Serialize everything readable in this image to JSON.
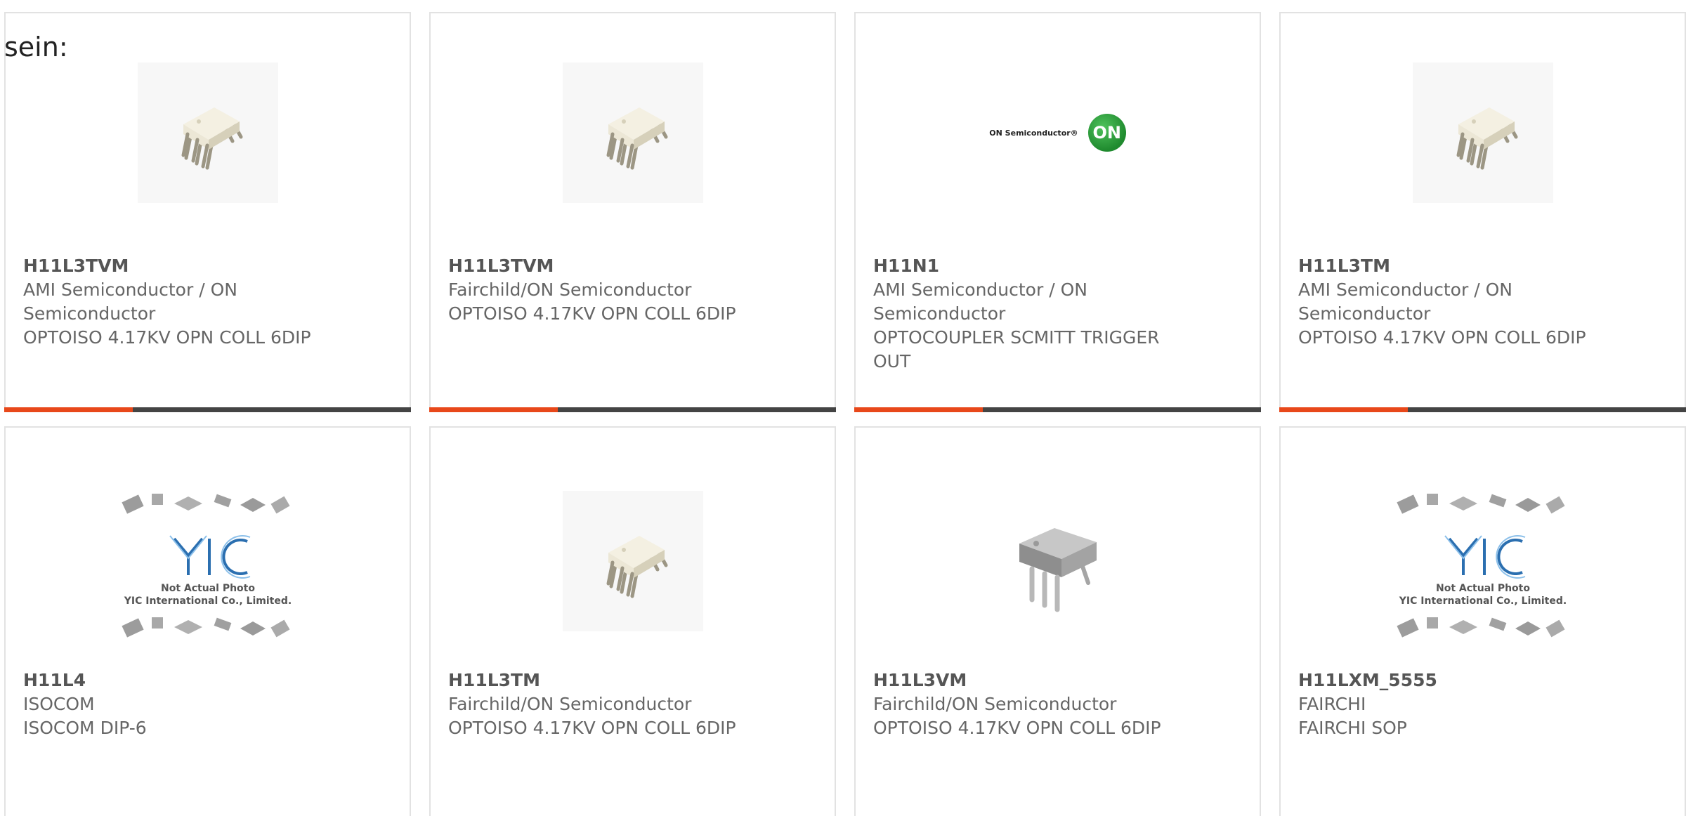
{
  "intro_text": "sein:",
  "colors": {
    "accent": "#e8481a",
    "bar_dark": "#444444",
    "card_border": "#e2e2e2",
    "text_muted": "#666666",
    "on_logo_green": "#1f8a2e"
  },
  "products": [
    {
      "part_number": "H11L3TVM",
      "manufacturer": "AMI Semiconductor / ON Semiconductor",
      "description": "OPTOISO 4.17KV OPN COLL 6DIP",
      "image": "optocoupler-dip6-photo"
    },
    {
      "part_number": "H11L3TVM",
      "manufacturer": "Fairchild/ON Semiconductor",
      "description": "OPTOISO 4.17KV OPN COLL 6DIP",
      "image": "optocoupler-dip6-photo"
    },
    {
      "part_number": "H11N1",
      "manufacturer": "AMI Semiconductor / ON Semiconductor",
      "description": "OPTOCOUPLER SCMITT TRIGGER OUT",
      "image": "on-semiconductor-logo",
      "logo_text": "ON Semiconductor®",
      "logo_badge": "ON"
    },
    {
      "part_number": "H11L3TM",
      "manufacturer": "AMI Semiconductor / ON Semiconductor",
      "description": "OPTOISO 4.17KV OPN COLL 6DIP",
      "image": "optocoupler-dip6-photo"
    },
    {
      "part_number": "H11L4",
      "manufacturer": "ISOCOM",
      "description": "ISOCOM DIP-6",
      "image": "yic-placeholder",
      "placeholder_line1": "Not Actual Photo",
      "placeholder_line2": "YIC International Co., Limited."
    },
    {
      "part_number": "H11L3TM",
      "manufacturer": "Fairchild/ON Semiconductor",
      "description": "OPTOISO 4.17KV OPN COLL 6DIP",
      "image": "optocoupler-dip6-photo"
    },
    {
      "part_number": "H11L3VM",
      "manufacturer": "Fairchild/ON Semiconductor",
      "description": "OPTOISO 4.17KV OPN COLL 6DIP",
      "image": "optocoupler-dip6-grey-photo"
    },
    {
      "part_number": "H11LXM_5555",
      "manufacturer": "FAIRCHI",
      "description": "FAIRCHI SOP",
      "image": "yic-placeholder",
      "placeholder_line1": "Not Actual Photo",
      "placeholder_line2": "YIC International Co., Limited."
    }
  ]
}
